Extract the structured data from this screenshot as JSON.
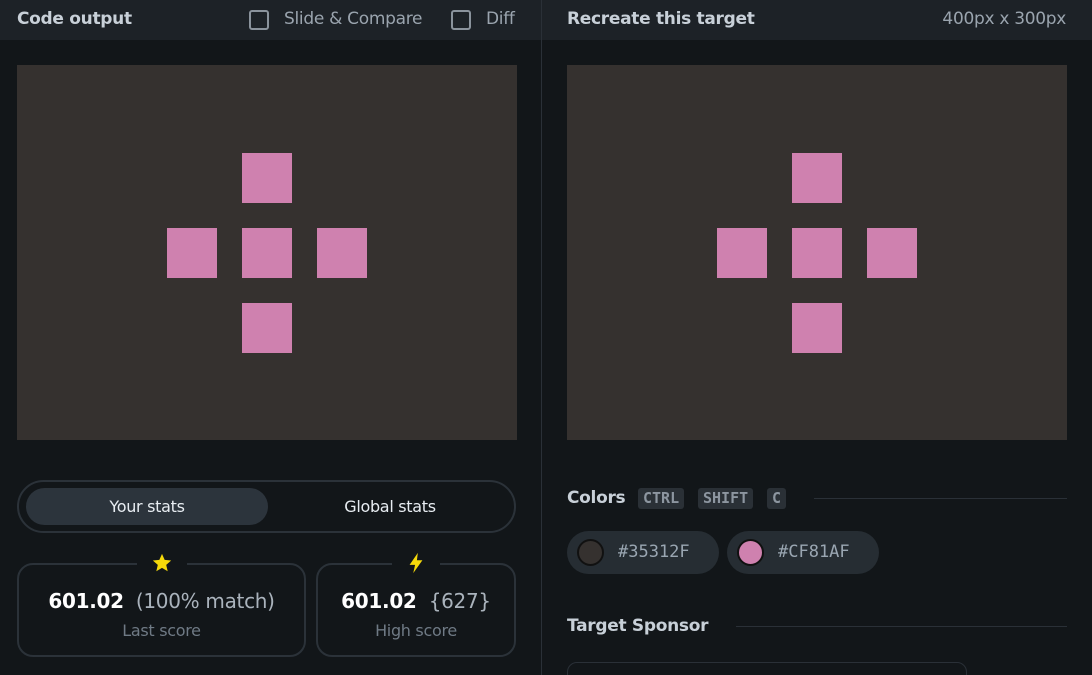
{
  "left_header": {
    "title": "Code output",
    "slide_compare_label": "Slide & Compare",
    "diff_label": "Diff"
  },
  "right_header": {
    "title": "Recreate this target",
    "dimensions": "400px x 300px"
  },
  "stats_toggle": {
    "your_stats": "Your stats",
    "global_stats": "Global stats"
  },
  "last_score": {
    "icon": "star-icon",
    "score": "601.02",
    "detail": "(100% match)",
    "label": "Last score"
  },
  "high_score": {
    "icon": "lightning-icon",
    "score": "601.02",
    "detail": "{627}",
    "label": "High score"
  },
  "colors": {
    "title": "Colors",
    "shortcut": [
      "CTRL",
      "SHIFT",
      "C"
    ],
    "swatches": [
      {
        "hex": "#35312F",
        "color": "#35312f"
      },
      {
        "hex": "#CF81AF",
        "color": "#cf81af"
      }
    ]
  },
  "sponsor": {
    "title": "Target Sponsor"
  },
  "theme": {
    "background": "#35312f",
    "accent": "#cf81af",
    "star_color": "#f5d90a",
    "bolt_color": "#f5d90a"
  }
}
